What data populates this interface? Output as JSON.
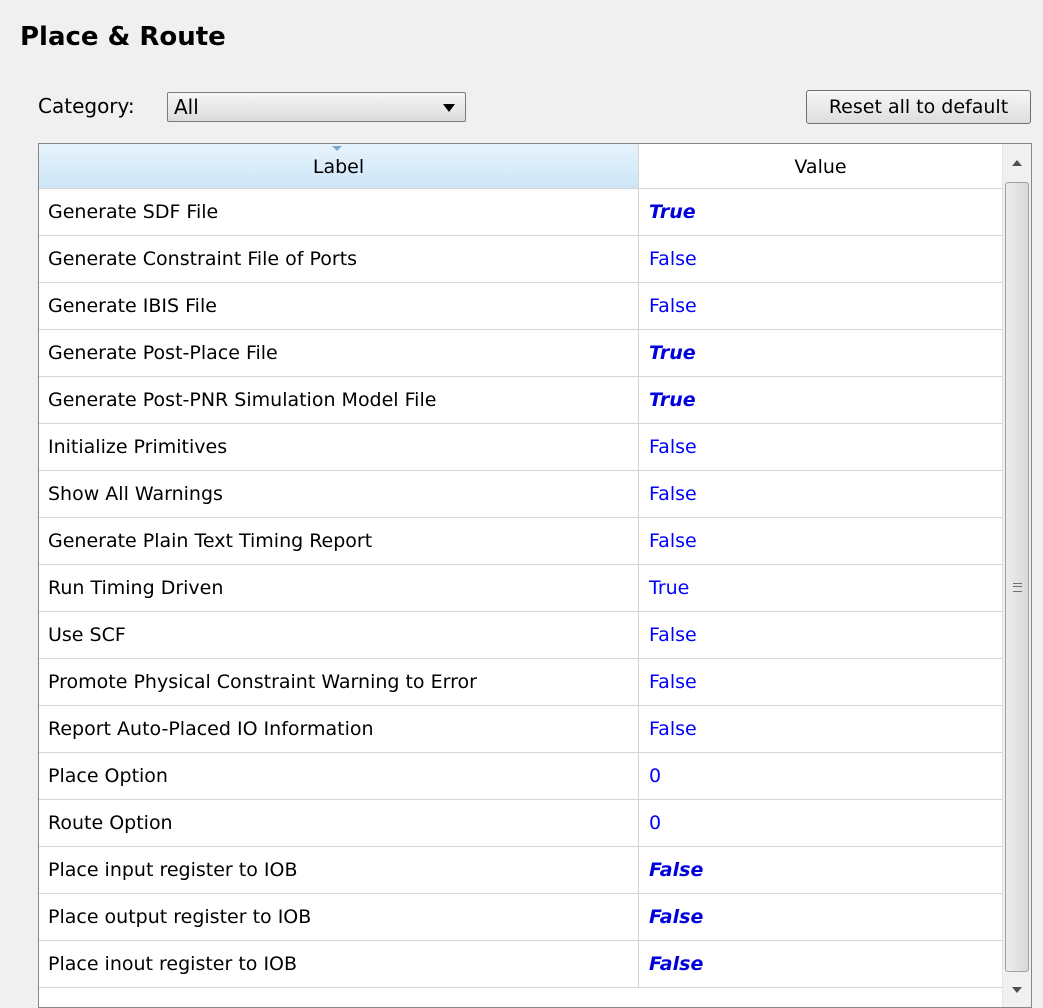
{
  "panel": {
    "title": "Place & Route"
  },
  "category": {
    "label": "Category:",
    "selected": "All"
  },
  "toolbar": {
    "reset_label": "Reset all to default"
  },
  "table": {
    "columns": [
      "Label",
      "Value"
    ],
    "rows": [
      {
        "label": "Generate SDF File",
        "value": "True",
        "modified": true
      },
      {
        "label": "Generate Constraint File of Ports",
        "value": "False",
        "modified": false
      },
      {
        "label": "Generate IBIS File",
        "value": "False",
        "modified": false
      },
      {
        "label": "Generate Post-Place File",
        "value": "True",
        "modified": true
      },
      {
        "label": "Generate Post-PNR Simulation Model File",
        "value": "True",
        "modified": true
      },
      {
        "label": "Initialize Primitives",
        "value": "False",
        "modified": false
      },
      {
        "label": "Show All Warnings",
        "value": "False",
        "modified": false
      },
      {
        "label": "Generate Plain Text Timing Report",
        "value": "False",
        "modified": false
      },
      {
        "label": "Run Timing Driven",
        "value": "True",
        "modified": false
      },
      {
        "label": "Use SCF",
        "value": "False",
        "modified": false
      },
      {
        "label": "Promote Physical Constraint Warning to Error",
        "value": "False",
        "modified": false
      },
      {
        "label": "Report Auto-Placed IO Information",
        "value": "False",
        "modified": false
      },
      {
        "label": "Place Option",
        "value": "0",
        "modified": false
      },
      {
        "label": "Route Option",
        "value": "0",
        "modified": false
      },
      {
        "label": "Place input register to IOB",
        "value": "False",
        "modified": true
      },
      {
        "label": "Place output register to IOB",
        "value": "False",
        "modified": true
      },
      {
        "label": "Place inout register to IOB",
        "value": "False",
        "modified": true
      }
    ]
  },
  "icons": {
    "dropdown": "chevron-down-icon",
    "sort": "sort-arrow-icon",
    "scroll_up": "scroll-up-icon",
    "scroll_down": "scroll-down-icon"
  },
  "colors": {
    "value_text": "#0000ff",
    "header_bg": "#cde6f7",
    "panel_bg": "#f0f0f0"
  }
}
